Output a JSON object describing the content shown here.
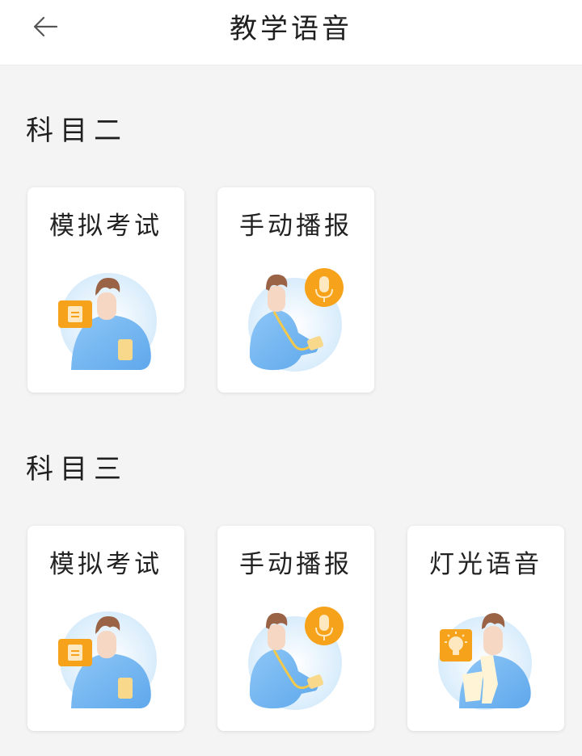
{
  "header": {
    "title": "教学语音",
    "back_icon": "back-arrow-icon"
  },
  "sections": [
    {
      "title": "科目二",
      "cards": [
        {
          "label": "模拟考试",
          "illustration": "mock-exam-illustration"
        },
        {
          "label": "手动播报",
          "illustration": "manual-broadcast-illustration"
        }
      ]
    },
    {
      "title": "科目三",
      "cards": [
        {
          "label": "模拟考试",
          "illustration": "mock-exam-illustration"
        },
        {
          "label": "手动播报",
          "illustration": "manual-broadcast-illustration"
        },
        {
          "label": "灯光语音",
          "illustration": "light-voice-illustration"
        }
      ]
    }
  ],
  "colors": {
    "page_bg": "#f4f4f4",
    "card_bg": "#ffffff",
    "figure_blue": "#6fb3f0",
    "badge_orange": "#f7a21b",
    "hair_brown": "#a0684a"
  }
}
